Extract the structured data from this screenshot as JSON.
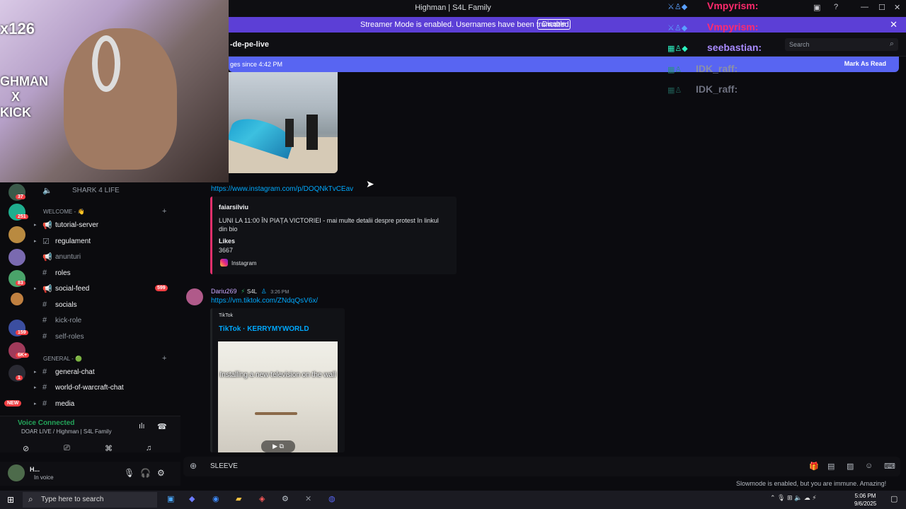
{
  "window": {
    "title": "Highman | S4L Family"
  },
  "streamer_banner": {
    "text": "Streamer Mode is enabled. Usernames have been truncated.",
    "button": "Disable"
  },
  "channel": {
    "name": "-de-pe-live",
    "search_placeholder": "Search"
  },
  "new_messages_bar": {
    "text": "ges since 4:42 PM",
    "action": "Mark As Read"
  },
  "overlay_chat": [
    {
      "name": "Vmpyrism:",
      "color": "#ff2a6d"
    },
    {
      "name": "Vmpyrism:",
      "color": "#ff2a6d"
    },
    {
      "name": "seebastian:",
      "color": "#a98bff"
    },
    {
      "name": "IDK_raff:",
      "color": "#8a8fa8"
    },
    {
      "name": "IDK_raff:",
      "color": "#6e7180"
    }
  ],
  "webcam": {
    "overlay_lines": [
      "x126",
      "GHMAN",
      "X",
      "KICK"
    ]
  },
  "server_badges": [
    "37",
    "251",
    "83",
    "159",
    "6K+",
    "1"
  ],
  "new_badge": "NEW",
  "channels": {
    "top_item": "SHARK 4 LIFE",
    "cat_welcome": "WELCOME - 👋",
    "cat_general": "GENERAL - 🟢",
    "items": [
      {
        "label": "tutorial-server"
      },
      {
        "label": "regulament"
      },
      {
        "label": "anunturi"
      },
      {
        "label": "roles"
      },
      {
        "label": "social-feed",
        "unread": "599"
      },
      {
        "label": "socials"
      },
      {
        "label": "kick-role"
      },
      {
        "label": "self-roles"
      },
      {
        "label": "general-chat"
      },
      {
        "label": "world-of-warcraft-chat"
      },
      {
        "label": "media"
      }
    ]
  },
  "messages": {
    "insta_link": "https://www.instagram.com/p/DOQNkTvCEav",
    "insta_embed": {
      "author": "faiarsilviu",
      "desc": "LUNI LA 11:00 ÎN PIAȚA VICTORIEI - mai multe detalii despre protest în linkul din bio",
      "field_name": "Likes",
      "field_value": "3667",
      "footer": "Instagram"
    },
    "msg2": {
      "author": "Dariu269",
      "tag": "S4L",
      "time": "3:26 PM",
      "link": "https://vm.tiktok.com/ZNdqQsV6x/",
      "provider": "TikTok",
      "title": "TikTok · KERRYMYWORLD",
      "video_caption": "Installing a new television on the wall"
    }
  },
  "voice": {
    "status": "Voice Connected",
    "server": "DOAR LIVE / Highman | S4L Family"
  },
  "user": {
    "name": "H...",
    "status": "In voice"
  },
  "composer": {
    "value": "SLEEVE"
  },
  "slowmode": "Slowmode is enabled, but you are immune. Amazing!",
  "taskbar": {
    "search_placeholder": "Type here to search",
    "time": "5:06 PM",
    "date": "9/6/2025"
  },
  "colors": {
    "accent": "#5865f2",
    "streamer": "#5c3fd6",
    "link": "#00a8fc",
    "danger": "#f23f43",
    "online": "#23a55a"
  }
}
